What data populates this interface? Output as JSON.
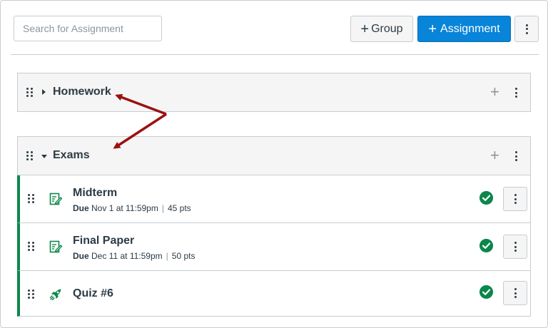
{
  "toolbar": {
    "search_placeholder": "Search for Assignment",
    "group_button_label": "Group",
    "assignment_button_label": "Assignment",
    "plus_symbol": "+"
  },
  "groups": [
    {
      "title": "Homework",
      "collapsed": true
    },
    {
      "title": "Exams",
      "collapsed": false,
      "items": [
        {
          "title": "Midterm",
          "icon": "assignment-icon",
          "due_label": "Due",
          "due": "Nov 1 at 11:59pm",
          "points": "45 pts",
          "published": true
        },
        {
          "title": "Final Paper",
          "icon": "assignment-icon",
          "due_label": "Due",
          "due": "Dec 11 at 11:59pm",
          "points": "50 pts",
          "published": true
        },
        {
          "title": "Quiz #6",
          "icon": "quiz-rocket-icon",
          "published": true
        }
      ]
    }
  ],
  "meta_separator": "|",
  "colors": {
    "accent": "#0884d9",
    "published": "#0b874b",
    "annotation_arrow": "#9b1111",
    "header_bg": "#f5f5f5",
    "border": "#c7cdd1"
  }
}
